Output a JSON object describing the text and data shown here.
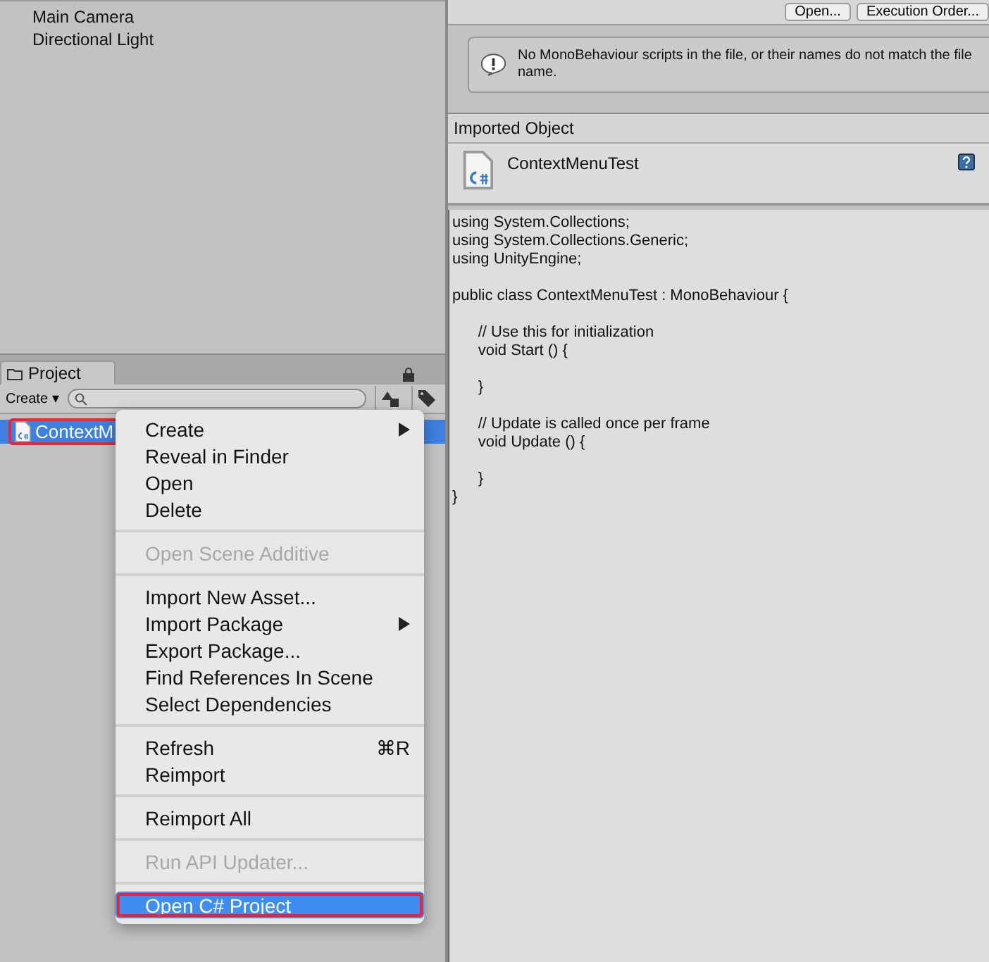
{
  "hierarchy": {
    "items": [
      "Main Camera",
      "Directional Light"
    ]
  },
  "project": {
    "tab": "Project",
    "create": "Create ▾",
    "assets": [
      {
        "name": "ContextM",
        "selected": true,
        "annotated": true
      }
    ]
  },
  "context_menu": {
    "groups": [
      [
        {
          "label": "Create",
          "disabled": false,
          "selected": false,
          "submenu": true,
          "annotated": false
        },
        {
          "label": "Reveal in Finder",
          "disabled": false,
          "selected": false,
          "submenu": false,
          "annotated": false
        },
        {
          "label": "Open",
          "disabled": false,
          "selected": false,
          "submenu": false,
          "annotated": false
        },
        {
          "label": "Delete",
          "disabled": false,
          "selected": false,
          "submenu": false,
          "annotated": false
        }
      ],
      [
        {
          "label": "Open Scene Additive",
          "disabled": true,
          "selected": false,
          "submenu": false,
          "annotated": false
        }
      ],
      [
        {
          "label": "Import New Asset...",
          "disabled": false,
          "selected": false,
          "submenu": false,
          "annotated": false
        },
        {
          "label": "Import Package",
          "disabled": false,
          "selected": false,
          "submenu": true,
          "annotated": false
        },
        {
          "label": "Export Package...",
          "disabled": false,
          "selected": false,
          "submenu": false,
          "annotated": false
        },
        {
          "label": "Find References In Scene",
          "disabled": false,
          "selected": false,
          "submenu": false,
          "annotated": false
        },
        {
          "label": "Select Dependencies",
          "disabled": false,
          "selected": false,
          "submenu": false,
          "annotated": false
        }
      ],
      [
        {
          "label": "Refresh",
          "shortcut": "⌘R",
          "disabled": false,
          "selected": false,
          "submenu": false,
          "annotated": false
        },
        {
          "label": "Reimport",
          "disabled": false,
          "selected": false,
          "submenu": false,
          "annotated": false
        }
      ],
      [
        {
          "label": "Reimport All",
          "disabled": false,
          "selected": false,
          "submenu": false,
          "annotated": false
        }
      ],
      [
        {
          "label": "Run API Updater...",
          "disabled": true,
          "selected": false,
          "submenu": false,
          "annotated": false
        }
      ],
      [
        {
          "label": "Open C# Project",
          "disabled": false,
          "selected": true,
          "submenu": false,
          "annotated": true
        }
      ]
    ]
  },
  "inspector": {
    "buttons": [
      "Open...",
      "Execution Order..."
    ],
    "message": "No MonoBehaviour scripts in the file, or their names do not match the file name.",
    "section_title": "Imported Object",
    "object_name": "ContextMenuTest",
    "code_blocks": [
      [
        "using System.Collections;",
        "using System.Collections.Generic;",
        "using UnityEngine;"
      ],
      [
        "public class ContextMenuTest : MonoBehaviour {"
      ],
      [
        "\t// Use this for initialization",
        "\tvoid Start () {"
      ],
      [
        "\t}"
      ],
      [
        "\t// Update is called once per frame",
        "\tvoid Update () {"
      ],
      [
        "\t}",
        "}"
      ]
    ]
  }
}
